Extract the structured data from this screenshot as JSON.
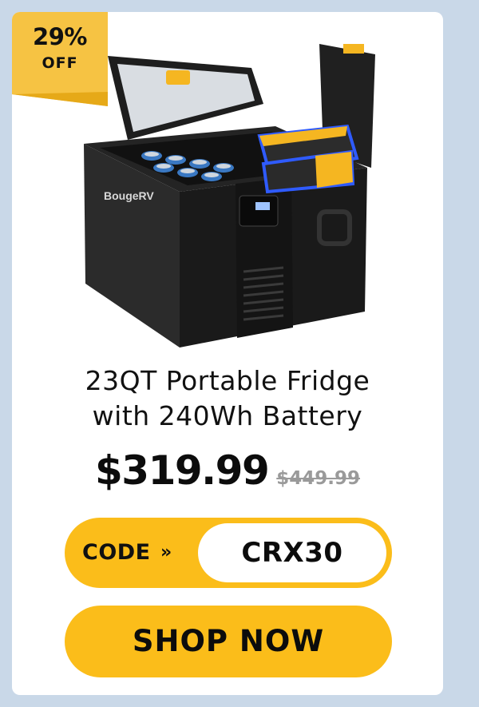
{
  "badge": {
    "percent": "29%",
    "label": "OFF"
  },
  "product": {
    "brand": "BougeRV",
    "title_line1": "23QT Portable Fridge",
    "title_line2": "with 240Wh Battery",
    "image_name": "portable-fridge-with-battery"
  },
  "pricing": {
    "sale_price": "$319.99",
    "original_price": "$449.99"
  },
  "promo": {
    "code_label": "CODE",
    "code": "CRX30"
  },
  "cta": {
    "label": "SHOP NOW"
  },
  "colors": {
    "background": "#c9d8e8",
    "card": "#ffffff",
    "accent": "#fbbd1a",
    "text": "#111111",
    "strike": "#9a9a9a"
  }
}
